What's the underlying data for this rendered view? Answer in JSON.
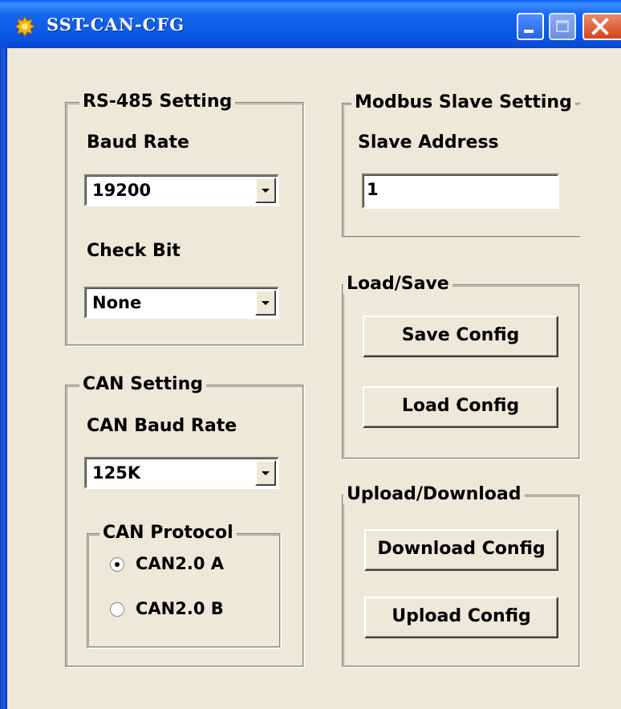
{
  "window": {
    "title": "SST-CAN-CFG",
    "icon": "app-icon"
  },
  "rs485": {
    "legend": "RS-485 Setting",
    "baud_label": "Baud Rate",
    "baud_value": "19200",
    "check_label": "Check Bit",
    "check_value": "None"
  },
  "can": {
    "legend": "CAN Setting",
    "baud_label": "CAN Baud Rate",
    "baud_value": "125K",
    "protocol": {
      "legend": "CAN Protocol",
      "options": [
        {
          "label": "CAN2.0 A",
          "selected": true
        },
        {
          "label": "CAN2.0 B",
          "selected": false
        }
      ]
    }
  },
  "modbus": {
    "legend": "Modbus Slave Setting",
    "address_label": "Slave Address",
    "address_value": "1"
  },
  "loadsave": {
    "legend": "Load/Save",
    "save_label": "Save Config",
    "load_label": "Load Config"
  },
  "updown": {
    "legend": "Upload/Download",
    "download_label": "Download Config",
    "upload_label": "Upload Config"
  }
}
